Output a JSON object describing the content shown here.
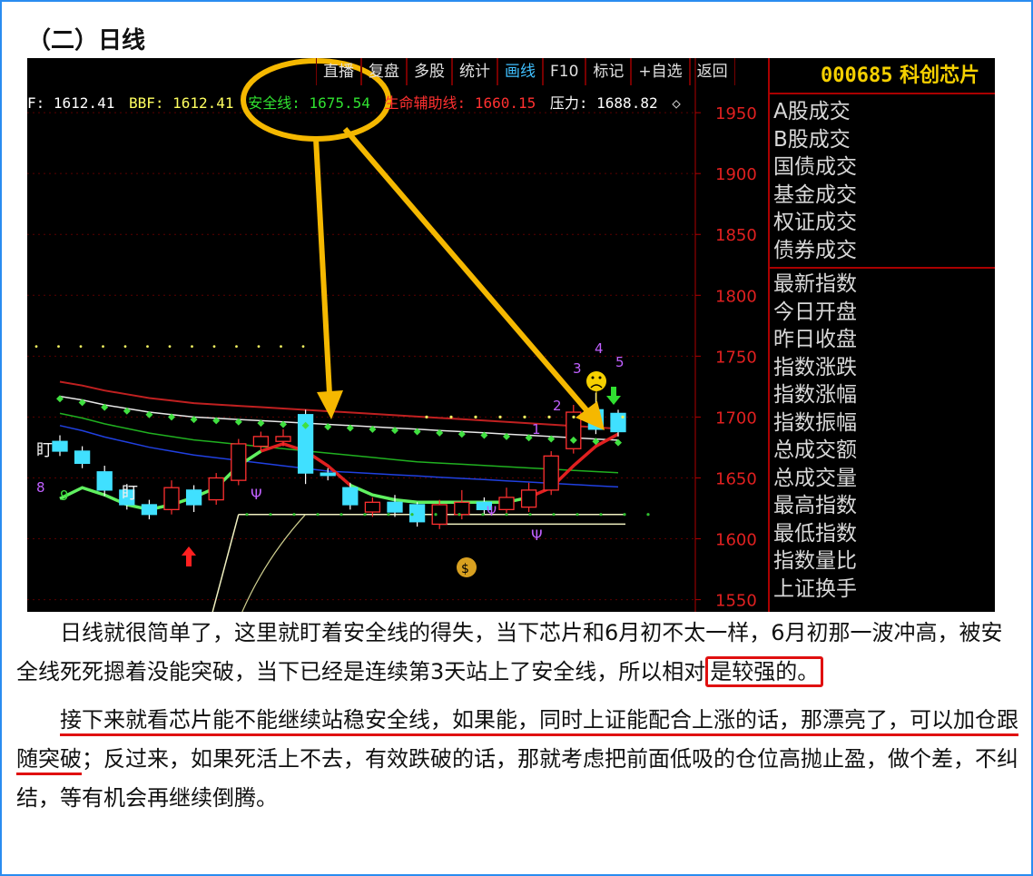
{
  "heading": "（二）日线",
  "chart_panel": {
    "toolbar": [
      "直播",
      "复盘",
      "多股",
      "统计",
      "画线",
      "F10",
      "标记",
      "+自选",
      "返回"
    ],
    "active_tab": "画线",
    "infobar": {
      "f": "F: 1612.41",
      "bbf": "BBF: 1612.41",
      "safety": "安全线: 1675.54",
      "lifeline": "生命辅助线: 1660.15",
      "pressure": "压力: 1688.82",
      "colors": {
        "f": "#ffffff",
        "bbf": "#ffff60",
        "safety": "#30e030",
        "lifeline": "#ff3030",
        "pressure": "#ffffff"
      }
    },
    "stock_code": "000685",
    "stock_name": "科创芯片",
    "side_group1": [
      "A股成交",
      "B股成交",
      "国债成交",
      "基金成交",
      "权证成交",
      "债券成交"
    ],
    "side_group2": [
      "最新指数",
      "今日开盘",
      "昨日收盘",
      "指数涨跌",
      "指数涨幅",
      "指数振幅",
      "总成交额",
      "总成交量",
      "最高指数",
      "最低指数",
      "指数量比",
      "上证换手"
    ],
    "marks": {
      "m8": "8",
      "m9": "9",
      "ding1": "盯",
      "ding2": "盯",
      "psi": "Ψ",
      "n1": "1",
      "n2": "2",
      "n3": "3",
      "n4": "4",
      "n5": "5"
    }
  },
  "chart_data": {
    "type": "candlestick",
    "ylim": [
      1540,
      1965
    ],
    "yticks": [
      1950,
      1900,
      1850,
      1800,
      1750,
      1700,
      1650,
      1600,
      1550
    ],
    "candles": [
      {
        "o": 1680,
        "c": 1672,
        "h": 1685,
        "l": 1668
      },
      {
        "o": 1672,
        "c": 1662,
        "h": 1676,
        "l": 1658
      },
      {
        "o": 1655,
        "c": 1640,
        "h": 1660,
        "l": 1635
      },
      {
        "o": 1640,
        "c": 1628,
        "h": 1645,
        "l": 1624
      },
      {
        "o": 1628,
        "c": 1620,
        "h": 1632,
        "l": 1616
      },
      {
        "o": 1624,
        "c": 1642,
        "h": 1648,
        "l": 1620
      },
      {
        "o": 1640,
        "c": 1628,
        "h": 1644,
        "l": 1622
      },
      {
        "o": 1632,
        "c": 1650,
        "h": 1654,
        "l": 1628
      },
      {
        "o": 1648,
        "c": 1678,
        "h": 1682,
        "l": 1644
      },
      {
        "o": 1676,
        "c": 1684,
        "h": 1688,
        "l": 1672
      },
      {
        "o": 1680,
        "c": 1684,
        "h": 1690,
        "l": 1676
      },
      {
        "o": 1702,
        "c": 1654,
        "h": 1706,
        "l": 1645
      },
      {
        "o": 1654,
        "c": 1652,
        "h": 1658,
        "l": 1648
      },
      {
        "o": 1642,
        "c": 1628,
        "h": 1646,
        "l": 1624
      },
      {
        "o": 1622,
        "c": 1630,
        "h": 1634,
        "l": 1618
      },
      {
        "o": 1630,
        "c": 1622,
        "h": 1636,
        "l": 1618
      },
      {
        "o": 1628,
        "c": 1614,
        "h": 1630,
        "l": 1610
      },
      {
        "o": 1612,
        "c": 1628,
        "h": 1632,
        "l": 1608
      },
      {
        "o": 1620,
        "c": 1630,
        "h": 1640,
        "l": 1616
      },
      {
        "o": 1630,
        "c": 1624,
        "h": 1634,
        "l": 1620
      },
      {
        "o": 1624,
        "c": 1634,
        "h": 1642,
        "l": 1620
      },
      {
        "o": 1626,
        "c": 1640,
        "h": 1646,
        "l": 1622
      },
      {
        "o": 1640,
        "c": 1668,
        "h": 1672,
        "l": 1636
      },
      {
        "o": 1674,
        "c": 1704,
        "h": 1710,
        "l": 1670
      },
      {
        "o": 1706,
        "c": 1690,
        "h": 1720,
        "l": 1686
      },
      {
        "o": 1703,
        "c": 1688,
        "h": 1706,
        "l": 1684
      }
    ],
    "series": [
      {
        "name": "安全线",
        "values": [
          1715,
          1712,
          1708,
          1705,
          1702,
          1700,
          1698,
          1697,
          1696,
          1695,
          1694,
          1693,
          1692,
          1691,
          1690,
          1689,
          1688,
          1687,
          1686,
          1685,
          1684,
          1683,
          1682,
          1681,
          1680,
          1679
        ]
      },
      {
        "name": "生命辅助线",
        "values": [
          1633,
          1642,
          1636,
          1628,
          1624,
          1628,
          1634,
          1642,
          1660,
          1672,
          1678,
          1672,
          1660,
          1644,
          1636,
          1632,
          1630,
          1630,
          1630,
          1630,
          1630,
          1634,
          1642,
          1660,
          1676,
          1686
        ]
      }
    ]
  },
  "paragraph1": {
    "pre": "日线就很简单了，这里就盯着安全线的得失，当下芯片和6月初不太一样，6月初那一波冲高，被安全线死死摁着没能突破，当下已经是连续第3天站上了安全线，所以相对",
    "boxed": "是较强的。"
  },
  "paragraph2": {
    "underlined": "接下来就看芯片能不能继续站稳安全线，如果能，同时上证能配合上涨的话，那漂亮了，可以加仓跟随突破",
    "rest": "；反过来，如果死活上不去，有效跌破的话，那就考虑把前面低吸的仓位高抛止盈，做个差，不纠结，等有机会再继续倒腾。"
  }
}
